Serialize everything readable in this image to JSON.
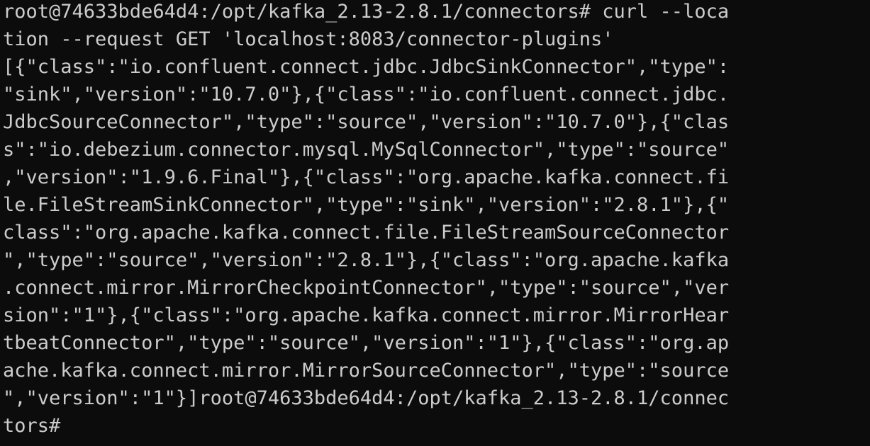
{
  "terminal": {
    "lines": [
      "root@74633bde64d4:/opt/kafka_2.13-2.8.1/connectors# curl --loca",
      "tion --request GET 'localhost:8083/connector-plugins'",
      "[{\"class\":\"io.confluent.connect.jdbc.JdbcSinkConnector\",\"type\":",
      "\"sink\",\"version\":\"10.7.0\"},{\"class\":\"io.confluent.connect.jdbc.",
      "JdbcSourceConnector\",\"type\":\"source\",\"version\":\"10.7.0\"},{\"clas",
      "s\":\"io.debezium.connector.mysql.MySqlConnector\",\"type\":\"source\"",
      ",\"version\":\"1.9.6.Final\"},{\"class\":\"org.apache.kafka.connect.fi",
      "le.FileStreamSinkConnector\",\"type\":\"sink\",\"version\":\"2.8.1\"},{\"",
      "class\":\"org.apache.kafka.connect.file.FileStreamSourceConnector",
      "\",\"type\":\"source\",\"version\":\"2.8.1\"},{\"class\":\"org.apache.kafka",
      ".connect.mirror.MirrorCheckpointConnector\",\"type\":\"source\",\"ver",
      "sion\":\"1\"},{\"class\":\"org.apache.kafka.connect.mirror.MirrorHear",
      "tbeatConnector\",\"type\":\"source\",\"version\":\"1\"},{\"class\":\"org.ap",
      "ache.kafka.connect.mirror.MirrorSourceConnector\",\"type\":\"source",
      "\",\"version\":\"1\"}]root@74633bde64d4:/opt/kafka_2.13-2.8.1/connec",
      "tors#"
    ]
  },
  "colors": {
    "background": "#0c0c0c",
    "foreground": "#cccccc"
  }
}
